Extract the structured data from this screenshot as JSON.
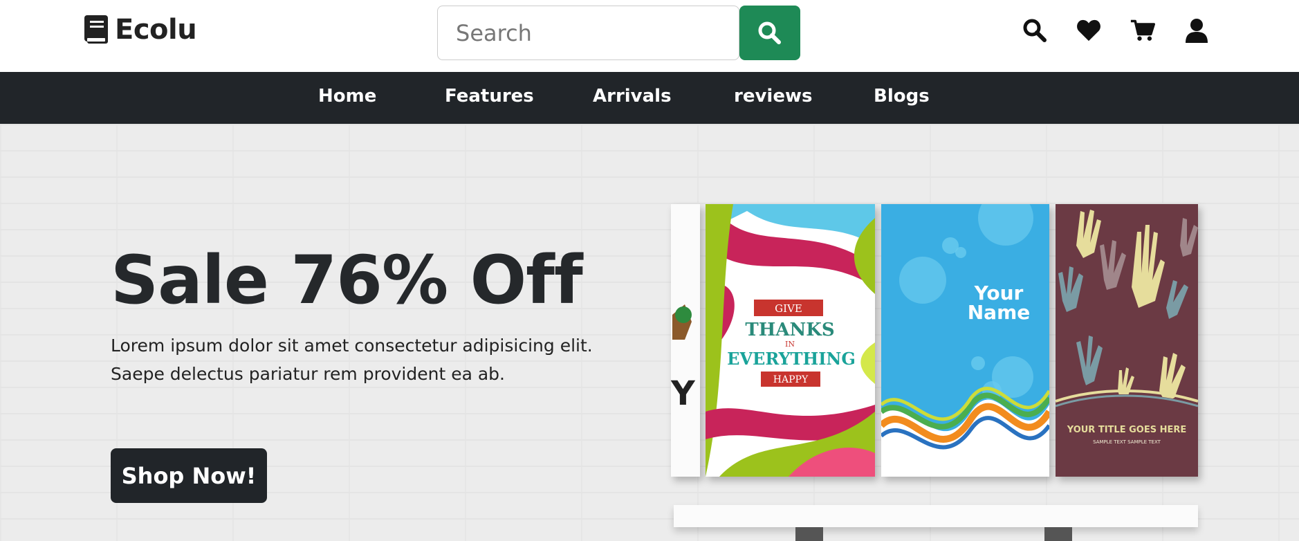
{
  "header": {
    "logo_text": "Ecolu",
    "search_placeholder": "Search"
  },
  "nav": {
    "items": [
      "Home",
      "Features",
      "Arrivals",
      "reviews",
      "Blogs"
    ]
  },
  "hero": {
    "title": "Sale 76% Off",
    "description": "Lorem ipsum dolor sit amet consectetur adipisicing elit. Saepe delectus pariatur rem provident ea ab.",
    "button": "Shop Now!"
  },
  "books": {
    "book1": {
      "give": "GIVE",
      "thanks": "THANKS",
      "in": "IN",
      "everything": "EVERYTHING",
      "happy": "HAPPY"
    },
    "book2": {
      "name_line1": "Your",
      "name_line2": "Name"
    },
    "book3": {
      "title": "YOUR TITLE GOES HERE",
      "subtitle": "SAMPLE TEXT SAMPLE TEXT"
    },
    "partial_letter": "Y"
  },
  "colors": {
    "accent_green": "#1e8a56",
    "nav_dark": "#212529"
  }
}
